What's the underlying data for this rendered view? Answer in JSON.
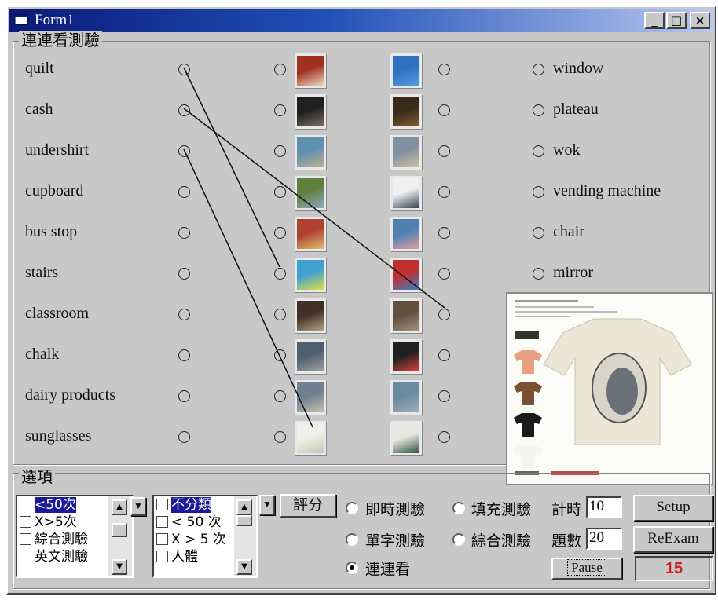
{
  "window": {
    "title": "Form1",
    "min_label": "_",
    "max_label": "□",
    "close_label": "×"
  },
  "matching": {
    "group_label": "連連看測驗",
    "words": [
      "quilt",
      "cash",
      "undershirt",
      "cupboard",
      "bus stop",
      "stairs",
      "classroom",
      "chalk",
      "dairy products",
      "sunglasses"
    ],
    "right_words": [
      "window",
      "plateau",
      "wok",
      "vending machine",
      "chair",
      "mirror"
    ]
  },
  "options": {
    "group_label": "選項",
    "list1": [
      {
        "label": "<50次",
        "selected": true
      },
      {
        "label": "X>5次",
        "selected": false
      },
      {
        "label": "綜合測驗",
        "selected": false
      },
      {
        "label": "英文測驗",
        "selected": false
      }
    ],
    "list2": [
      {
        "label": "不分類",
        "selected": true
      },
      {
        "label": "< 50 次",
        "selected": false
      },
      {
        "label": "X > 5 次",
        "selected": false
      },
      {
        "label": "人體",
        "selected": false
      }
    ],
    "score_button": "評分",
    "modes": [
      {
        "label": "即時測驗",
        "checked": false
      },
      {
        "label": "填充測驗",
        "checked": false
      },
      {
        "label": "單字測驗",
        "checked": false
      },
      {
        "label": "綜合測驗",
        "checked": false
      },
      {
        "label": "連連看",
        "checked": true
      }
    ],
    "timer_label": "計時",
    "timer_value": "10",
    "count_label": "題數",
    "count_value": "20",
    "setup_button": "Setup",
    "reexam_button": "ReExam",
    "pause_button": "Pause",
    "score_display": "15"
  },
  "colors": {
    "score_text": "#d02020",
    "titlebar": "#0a1a78",
    "face": "#c8c8c8"
  }
}
